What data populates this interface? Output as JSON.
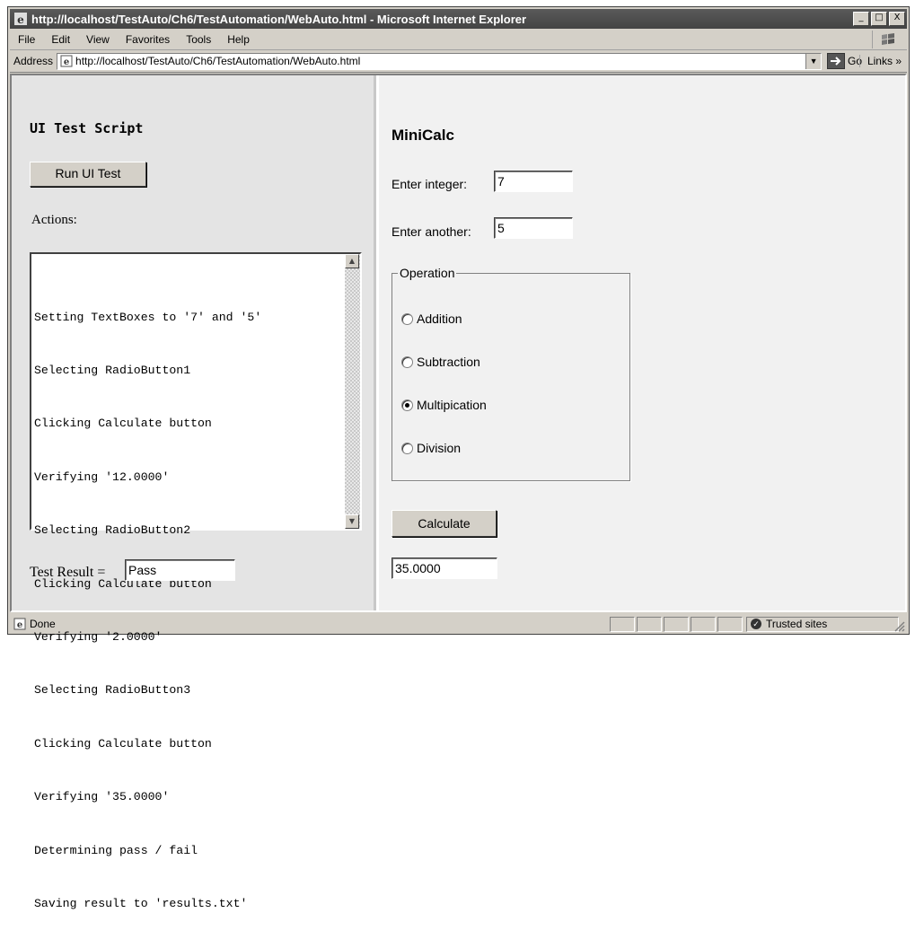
{
  "window": {
    "title": "http://localhost/TestAuto/Ch6/TestAutomation/WebAuto.html - Microsoft Internet Explorer",
    "minimize": "_",
    "maximize": "□",
    "close": "X"
  },
  "menu": [
    "File",
    "Edit",
    "View",
    "Favorites",
    "Tools",
    "Help"
  ],
  "address": {
    "label": "Address",
    "url": "http://localhost/TestAuto/Ch6/TestAutomation/WebAuto.html",
    "go": "Go",
    "links": "Links »"
  },
  "left": {
    "title": "UI Test Script",
    "run_button": "Run UI Test",
    "actions_label": "Actions:",
    "log_lines": [
      "Setting TextBoxes to '7' and '5'",
      "Selecting RadioButton1",
      "Clicking Calculate button",
      "Verifying '12.0000'",
      "Selecting RadioButton2",
      "Clicking Calculate button",
      "Verifying '2.0000'",
      "Selecting RadioButton3",
      "Clicking Calculate button",
      "Verifying '35.0000'",
      "Determining pass / fail",
      "Saving result to 'results.txt'"
    ],
    "test_result_label": "Test Result =",
    "test_result_value": "Pass"
  },
  "right": {
    "title": "MiniCalc",
    "label1": "Enter integer:",
    "value1": "7",
    "label2": "Enter another:",
    "value2": "5",
    "operation_legend": "Operation",
    "operations": [
      {
        "label": "Addition",
        "selected": false
      },
      {
        "label": "Subtraction",
        "selected": false
      },
      {
        "label": "Multipication",
        "selected": true
      },
      {
        "label": "Division",
        "selected": false
      }
    ],
    "calculate_button": "Calculate",
    "result": "35.0000"
  },
  "status": {
    "text": "Done",
    "zone": "Trusted sites"
  }
}
